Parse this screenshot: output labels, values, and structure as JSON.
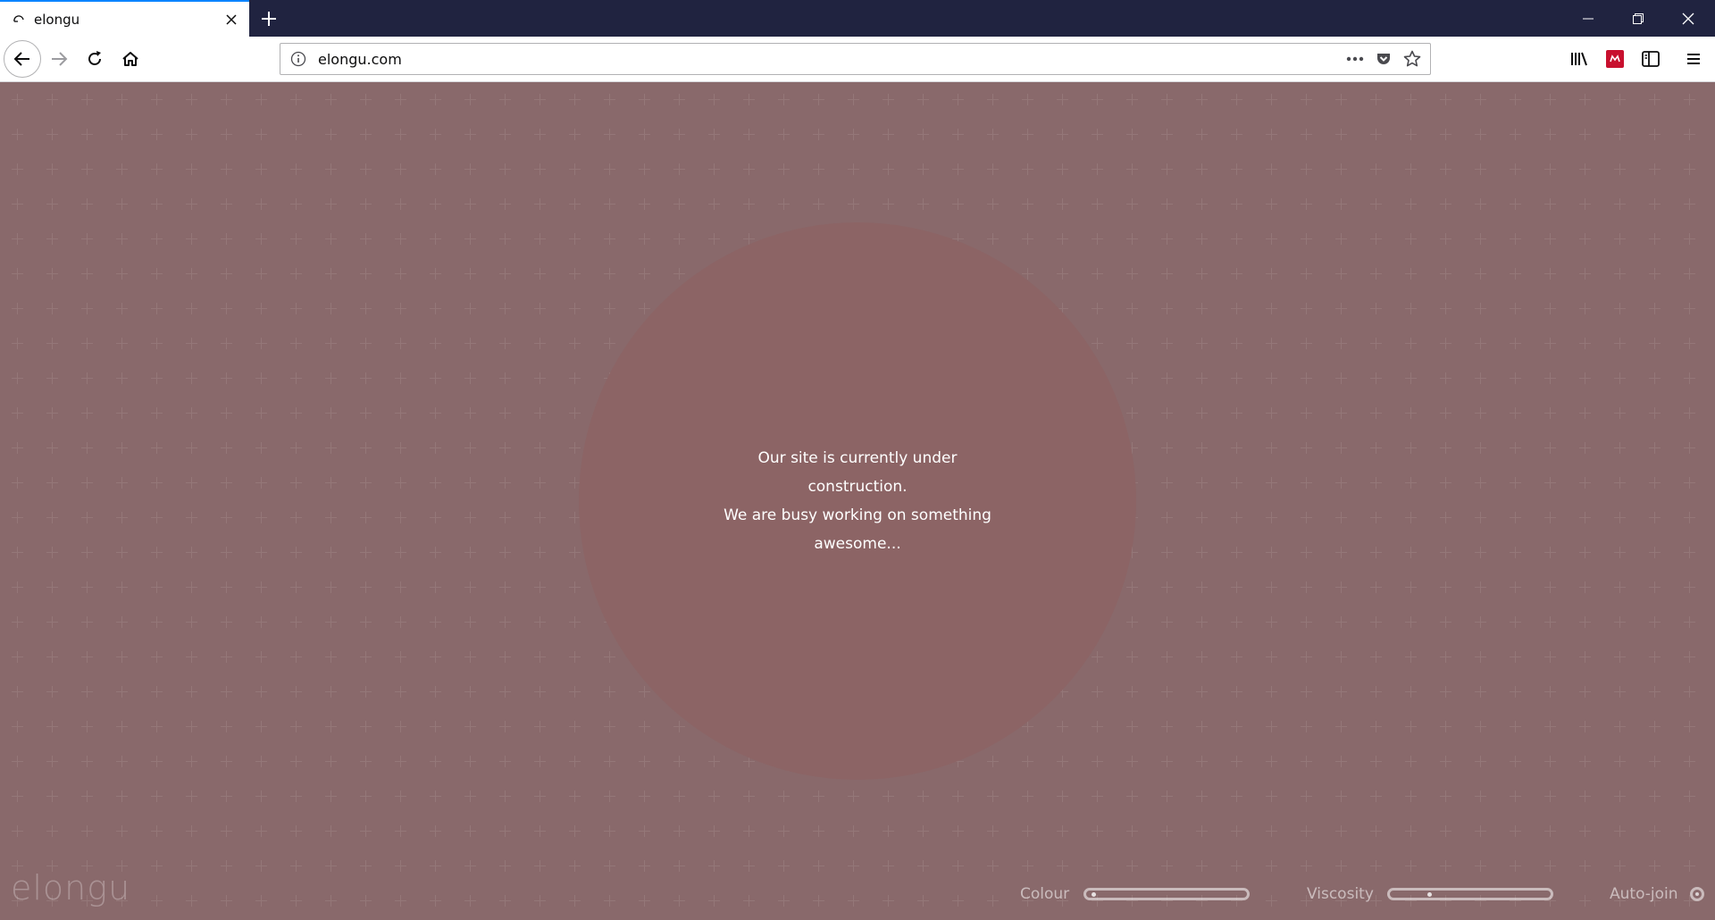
{
  "browser": {
    "tab": {
      "title": "elongu"
    },
    "url": "elongu.com",
    "colors": {
      "tabstrip": "#202340",
      "accent": "#0a84ff"
    }
  },
  "page": {
    "message_lines": [
      "Our site is currently under construction.",
      "We are busy working on something awesome..."
    ],
    "logo_text": "elongu",
    "controls": {
      "colour_label": "Colour",
      "colour_value": 0.02,
      "viscosity_label": "Viscosity",
      "viscosity_value": 0.23,
      "autojoin_label": "Auto-join"
    },
    "colors": {
      "background": "#6d4547",
      "circle": "#8c6465"
    }
  }
}
